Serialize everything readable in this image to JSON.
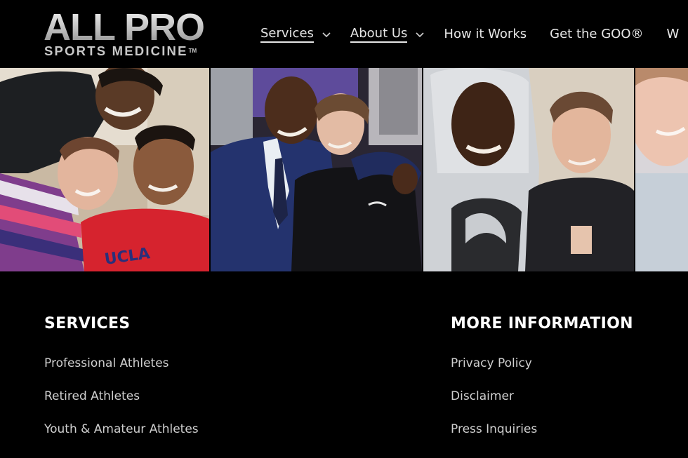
{
  "brand": {
    "logo_line1": "ALL PRO",
    "logo_line2": "SPORTS MEDICINE",
    "logo_tm": "TM"
  },
  "nav": {
    "items": [
      {
        "label": "Services",
        "dropdown": true,
        "active": true
      },
      {
        "label": "About Us",
        "dropdown": true,
        "active": true
      },
      {
        "label": "How it Works",
        "dropdown": false,
        "active": false
      },
      {
        "label": "Get the GOO®",
        "dropdown": false,
        "active": false
      },
      {
        "label": "W",
        "dropdown": false,
        "active": false
      }
    ]
  },
  "photos": [
    {
      "subject": "selfie of three smiling people"
    },
    {
      "subject": "man in suit hugging laughing woman"
    },
    {
      "subject": "man in hoodie with smiling woman"
    },
    {
      "subject": "partial smiling face"
    }
  ],
  "footer": {
    "services": {
      "heading": "SERVICES",
      "links": [
        "Professional Athletes",
        "Retired Athletes",
        "Youth & Amateur Athletes"
      ]
    },
    "more_info": {
      "heading": "MORE INFORMATION",
      "links": [
        "Privacy Policy",
        "Disclaimer",
        "Press Inquiries"
      ]
    }
  },
  "colors": {
    "background": "#000000",
    "text": "#ffffff",
    "link_text": "#cfcfcf",
    "logo_silver": "#c8c8c8"
  }
}
